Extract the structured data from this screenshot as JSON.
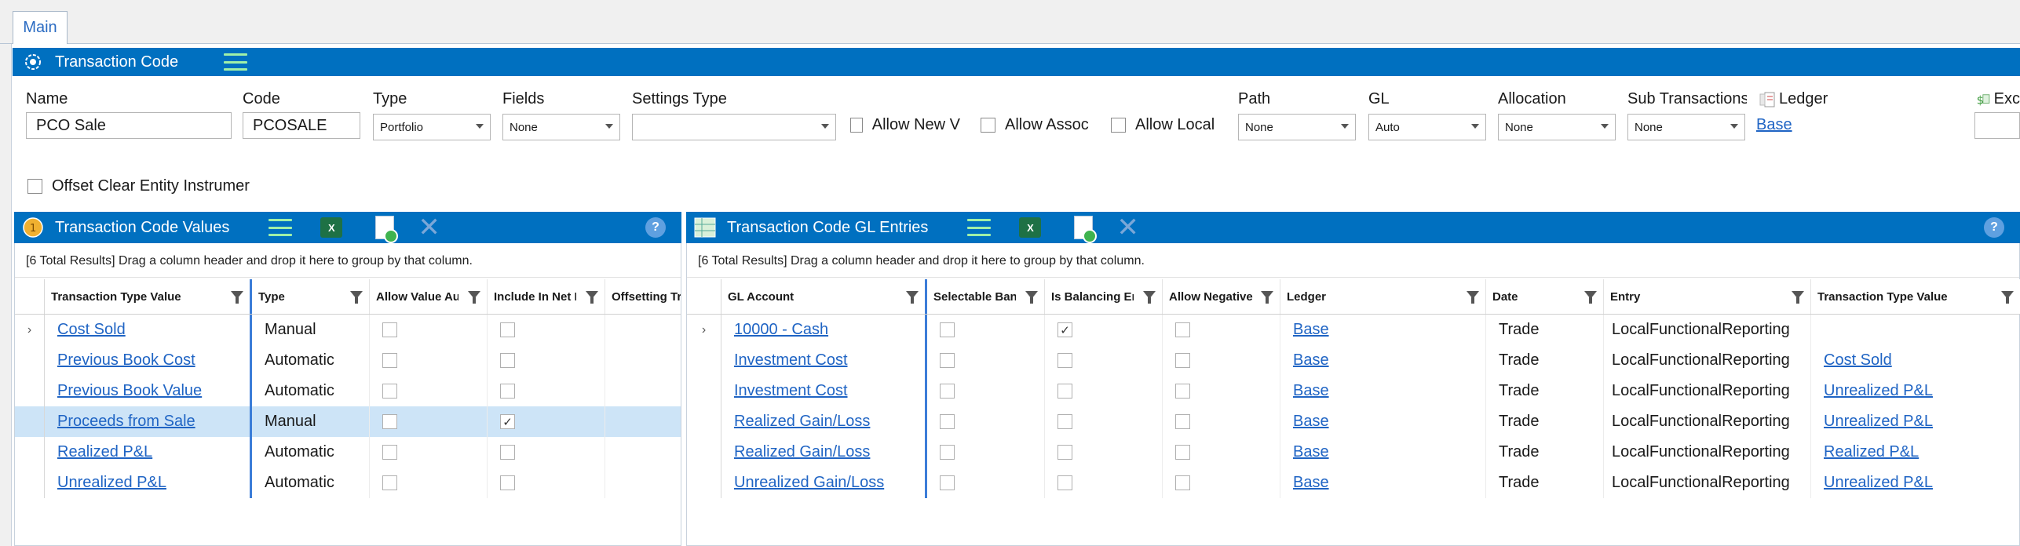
{
  "tabs": [
    {
      "label": "Main"
    }
  ],
  "header": {
    "title": "Transaction Code"
  },
  "form": {
    "name_label": "Name",
    "name_value": "PCO Sale",
    "code_label": "Code",
    "code_value": "PCOSALE",
    "type_label": "Type",
    "type_value": "Portfolio",
    "fields_label": "Fields",
    "fields_value": "None",
    "settings_type_label": "Settings Type",
    "settings_type_value": "",
    "allow_new_label": "Allow New V",
    "allow_assoc_label": "Allow Assoc",
    "allow_local_label": "Allow Local",
    "path_label": "Path",
    "path_value": "None",
    "gl_label": "GL",
    "gl_value": "Auto",
    "allocation_label": "Allocation",
    "allocation_value": "None",
    "sub_transactions_label": "Sub Transactions",
    "sub_transactions_value": "None",
    "ledger_label": "Ledger",
    "ledger_value": "Base",
    "exc_label": "Exc",
    "offset_label": "Offset Clear Entity Instrumer"
  },
  "values_panel": {
    "title": "Transaction Code Values",
    "group_hint": "[6 Total Results] Drag a column header and drop it here to group by that column.",
    "columns": [
      "Transaction Type Value",
      "Type",
      "Allow Value Au",
      "Include In Net I",
      "Offsetting Tra"
    ],
    "rows": [
      {
        "value": "Cost Sold",
        "type": "Manual",
        "allow": false,
        "include": false,
        "selected": false,
        "expander": "›"
      },
      {
        "value": "Previous Book Cost",
        "type": "Automatic",
        "allow": false,
        "include": false,
        "selected": false,
        "expander": ""
      },
      {
        "value": "Previous Book Value",
        "type": "Automatic",
        "allow": false,
        "include": false,
        "selected": false,
        "expander": ""
      },
      {
        "value": "Proceeds from Sale",
        "type": "Manual",
        "allow": false,
        "include": true,
        "selected": true,
        "expander": ""
      },
      {
        "value": "Realized P&L",
        "type": "Automatic",
        "allow": false,
        "include": false,
        "selected": false,
        "expander": ""
      },
      {
        "value": "Unrealized P&L",
        "type": "Automatic",
        "allow": false,
        "include": false,
        "selected": false,
        "expander": ""
      }
    ]
  },
  "gl_panel": {
    "title": "Transaction Code GL Entries",
    "group_hint": "[6 Total Results] Drag a column header and drop it here to group by that column.",
    "columns": [
      "GL Account",
      "Selectable Banl",
      "Is Balancing En",
      "Allow Negative",
      "Ledger",
      "Date",
      "Entry",
      "Transaction Type Value"
    ],
    "rows": [
      {
        "account": "10000 - Cash",
        "selectable": false,
        "balancing": true,
        "negative": false,
        "ledger": "Base",
        "date": "Trade",
        "entry": "LocalFunctionalReporting",
        "ttv": "",
        "expander": "›"
      },
      {
        "account": "Investment Cost",
        "selectable": false,
        "balancing": false,
        "negative": false,
        "ledger": "Base",
        "date": "Trade",
        "entry": "LocalFunctionalReporting",
        "ttv": "Cost Sold",
        "expander": ""
      },
      {
        "account": "Investment Cost",
        "selectable": false,
        "balancing": false,
        "negative": false,
        "ledger": "Base",
        "date": "Trade",
        "entry": "LocalFunctionalReporting",
        "ttv": "Unrealized P&L",
        "expander": ""
      },
      {
        "account": "Realized Gain/Loss",
        "selectable": false,
        "balancing": false,
        "negative": false,
        "ledger": "Base",
        "date": "Trade",
        "entry": "LocalFunctionalReporting",
        "ttv": "Unrealized P&L",
        "expander": ""
      },
      {
        "account": "Realized Gain/Loss",
        "selectable": false,
        "balancing": false,
        "negative": false,
        "ledger": "Base",
        "date": "Trade",
        "entry": "LocalFunctionalReporting",
        "ttv": "Realized P&L",
        "expander": ""
      },
      {
        "account": "Unrealized Gain/Loss",
        "selectable": false,
        "balancing": false,
        "negative": false,
        "ledger": "Base",
        "date": "Trade",
        "entry": "LocalFunctionalReporting",
        "ttv": "Unrealized P&L",
        "expander": ""
      }
    ]
  },
  "icons": {
    "excel_glyph": "X",
    "check_glyph": "✓",
    "close_glyph": "✕",
    "help_glyph": "?"
  },
  "colors": {
    "header_bar": "#0070c0",
    "selected_row": "#cde4f7",
    "link": "#1f64c4"
  }
}
